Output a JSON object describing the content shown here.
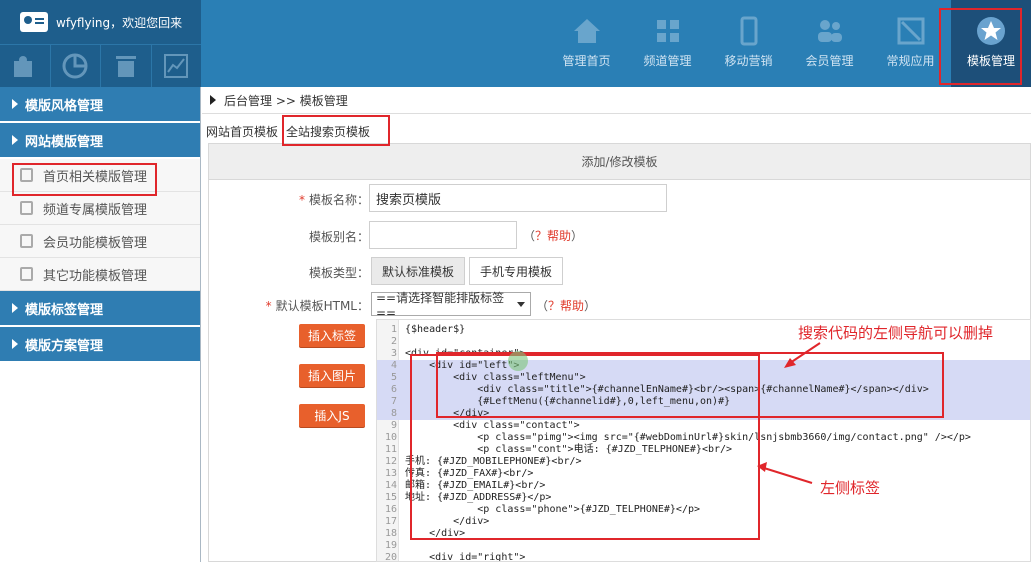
{
  "header": {
    "username": "wfyflying，欢迎您回来",
    "quick_icons": [
      "puzzle-icon",
      "pie-chart-icon",
      "trash-icon",
      "line-chart-icon"
    ],
    "nav": [
      {
        "label": "管理首页",
        "icon": "home-icon"
      },
      {
        "label": "频道管理",
        "icon": "grid-icon"
      },
      {
        "label": "移动营销",
        "icon": "mobile-icon"
      },
      {
        "label": "会员管理",
        "icon": "users-icon"
      },
      {
        "label": "常规应用",
        "icon": "app-icon"
      },
      {
        "label": "模板管理",
        "icon": "star-icon",
        "active": true
      }
    ]
  },
  "sidebar": {
    "cat1": "模版风格管理",
    "cat2": "网站模版管理",
    "items": [
      "首页相关模版管理",
      "频道专属模版管理",
      "会员功能模板管理",
      "其它功能模板管理"
    ],
    "cat3": "模版标签管理",
    "cat4": "模版方案管理"
  },
  "breadcrumb": "后台管理 >> 模板管理",
  "tabs": [
    "网站首页模板",
    "全站搜索页模板"
  ],
  "form": {
    "panel_title": "添加/修改模板",
    "name_label": "模板名称：",
    "name_value": "搜索页模版",
    "alias_label": "模板别名：",
    "help_text": "（",
    "help_q": "？帮助",
    "help_close": "）",
    "type_label": "模板类型：",
    "type_options": [
      "默认标准模板",
      "手机专用模板"
    ],
    "html_label": "默认模板HTML：",
    "select_value": "==请选择智能排版标签==",
    "buttons": [
      "插入标签",
      "插入图片",
      "插入JS"
    ]
  },
  "code_lines": [
    {
      "n": "1",
      "text": "{$header$}"
    },
    {
      "n": "2",
      "text": ""
    },
    {
      "n": "3",
      "text": "<div id=\"container\">"
    },
    {
      "n": "4",
      "text": "    <div id=\"left\">",
      "hl": true
    },
    {
      "n": "5",
      "text": "        <div class=\"leftMenu\">",
      "hl": true
    },
    {
      "n": "6",
      "text": "            <div class=\"title\">{#channelEnName#}<br/><span>{#channelName#}</span></div>",
      "hl": true
    },
    {
      "n": "7",
      "text": "            {#LeftMenu({#channelid#},0,left_menu,on)#}",
      "hl": true
    },
    {
      "n": "8",
      "text": "        </div>",
      "hl": true
    },
    {
      "n": "9",
      "text": "        <div class=\"contact\">"
    },
    {
      "n": "10",
      "text": "            <p class=\"pimg\"><img src=\"{#webDominUrl#}skin/lsnjsbmb3660/img/contact.png\" /></p>"
    },
    {
      "n": "11",
      "text": "            <p class=\"cont\">电话: {#JZD_TELPHONE#}<br/>"
    },
    {
      "n": "12",
      "text": "手机: {#JZD_MOBILEPHONE#}<br/>"
    },
    {
      "n": "13",
      "text": "传真: {#JZD_FAX#}<br/>"
    },
    {
      "n": "14",
      "text": "邮箱: {#JZD_EMAIL#}<br/>"
    },
    {
      "n": "15",
      "text": "地址: {#JZD_ADDRESS#}</p>"
    },
    {
      "n": "16",
      "text": "            <p class=\"phone\">{#JZD_TELPHONE#}</p>"
    },
    {
      "n": "17",
      "text": "        </div>"
    },
    {
      "n": "18",
      "text": "    </div>"
    },
    {
      "n": "19",
      "text": ""
    },
    {
      "n": "20",
      "text": "    <div id=\"right\">"
    }
  ],
  "annotations": {
    "top": "搜索代码的左侧导航可以删掉",
    "bottom": "左侧标签"
  },
  "colors": {
    "header": "#2a7fb5",
    "sidebar_cat": "#2f7db2",
    "button": "#e8602c",
    "annotation": "#e0262b"
  }
}
